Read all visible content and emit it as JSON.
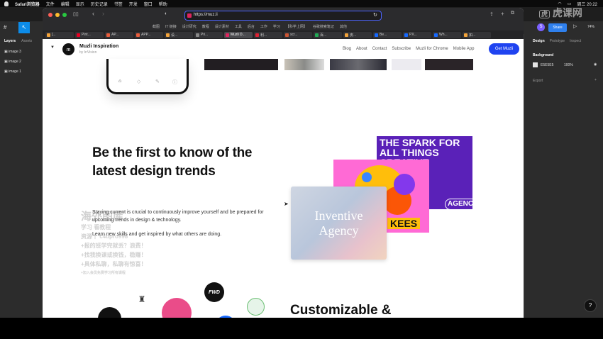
{
  "menubar": {
    "items": [
      "Safari浏览器",
      "文件",
      "编辑",
      "显示",
      "历史记录",
      "书签",
      "开发",
      "窗口",
      "帮助"
    ],
    "clock": "周三 20:22"
  },
  "browser": {
    "url": "https://muz.li",
    "bookmarks": [
      "截图",
      "IT 链接",
      "设计研究",
      "教程",
      "设计素材",
      "工具",
      "后台",
      "工作",
      "学习",
      "【科学上网】",
      "谷歌搜索笔记",
      "其他"
    ],
    "tabs": [
      {
        "label": "[..."
      },
      {
        "label": "Pint..."
      },
      {
        "label": "AP..."
      },
      {
        "label": "APP..."
      },
      {
        "label": "设..."
      },
      {
        "label": "Pri..."
      },
      {
        "label": "Muzli D...",
        "active": true
      },
      {
        "label": "利..."
      },
      {
        "label": "scr..."
      },
      {
        "label": "百..."
      },
      {
        "label": "皮..."
      },
      {
        "label": "Be..."
      },
      {
        "label": "PX..."
      },
      {
        "label": "Wh..."
      },
      {
        "label": "如..."
      }
    ]
  },
  "figma": {
    "left_tabs": [
      "Layers",
      "Assets"
    ],
    "layers": [
      "image 3",
      "image 2",
      "image 1"
    ],
    "right_tabs": [
      "Design",
      "Prototype",
      "Inspect"
    ],
    "share_label": "Share",
    "zoom": "74%",
    "background_label": "Background",
    "bg_color": "E5E5E5",
    "bg_opacity": "100%",
    "export_label": "Export",
    "user_initial": "S"
  },
  "site": {
    "brand": "Muzli Inspiration",
    "brand_sub": "by InVision",
    "nav": [
      "Blog",
      "About",
      "Contact",
      "Subscribe",
      "Muzli for Chrome",
      "Mobile App"
    ],
    "cta": "Get Muzli",
    "headline": "Be the first to know of the latest design trends",
    "para1": "Staying current is crucial to continuously improve yourself and be prepared for upcoming trends in design & technology.",
    "para2": "Learn new skills and get inspired by what others are doing.",
    "card_purple_text": "THE SPARK FOR ALL THINGS CREATIVE",
    "card_purple_bottom": "AGENCY",
    "card_colorful_text": "KEES",
    "card_glass_line1": "Inventive",
    "card_glass_line2": "Agency",
    "bottom_title": "Customizable &",
    "fwd_logo": "FWD"
  },
  "watermark": {
    "brand": "虎课网",
    "overlay_lines": [
      "海外图库",
      "学习 看教程",
      "资源丨 c4dpro998",
      "+报的班学完就丢？浪费！",
      "+找我换课或换钱，稳赚！",
      "+具体私聊，私聊有惊喜！",
      "+加入会员免费学习所有课程"
    ]
  },
  "colors": {
    "accent": "#1f43f0",
    "purple_card": "#5a21b8",
    "figma_share": "#2f80ed"
  }
}
